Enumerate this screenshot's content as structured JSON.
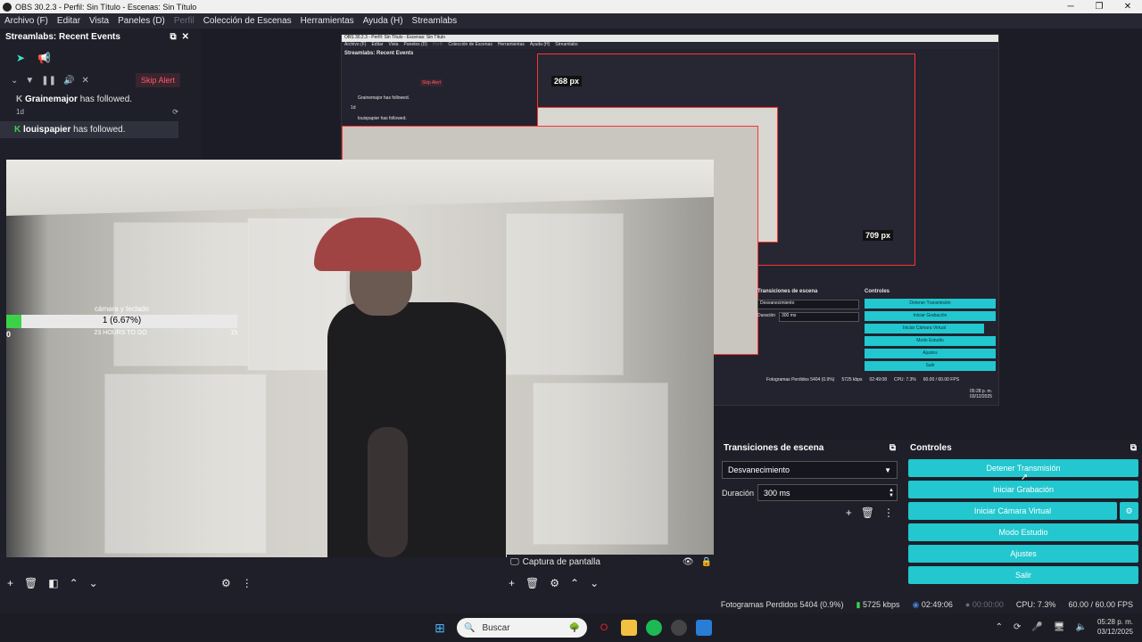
{
  "window": {
    "title": "OBS 30.2.3 - Perfil: Sin Título - Escenas: Sin Título"
  },
  "menu": [
    {
      "label": "Archivo (F)",
      "enabled": true
    },
    {
      "label": "Editar",
      "enabled": true
    },
    {
      "label": "Vista",
      "enabled": true
    },
    {
      "label": "Paneles (D)",
      "enabled": true
    },
    {
      "label": "Perfil",
      "enabled": false
    },
    {
      "label": "Colección de Escenas",
      "enabled": true
    },
    {
      "label": "Herramientas",
      "enabled": true
    },
    {
      "label": "Ayuda (H)",
      "enabled": true
    },
    {
      "label": "Streamlabs",
      "enabled": true
    }
  ],
  "events_panel": {
    "title": "Streamlabs: Recent Events",
    "skip_alert": "Skip Alert",
    "events": [
      {
        "user": "Grainemajor",
        "action": " has followed.",
        "time": "1d"
      },
      {
        "user": "louispapier",
        "action": " has followed.",
        "time": ""
      }
    ]
  },
  "nested": {
    "title": "OBS 30.2.3 - Perfil: Sin Título - Escenas: Sin Título",
    "menu": [
      "Archivo (F)",
      "Editar",
      "Vista",
      "Paneles (D)",
      "Perfil",
      "Colección de Escenas",
      "Herramientas",
      "Ayuda (H)",
      "Streamlabs"
    ],
    "events_title": "Streamlabs: Recent Events",
    "skip_alert": "Skip Alert",
    "ev1": "Grainemajor has followed.",
    "ev1_time": "1d",
    "ev2": "louispapier has followed.",
    "px_label_1": "268 px",
    "px_label_2": "709 px",
    "trans_title": "Transiciones de escena",
    "ctrl_title": "Controles",
    "trans_select": "Desvanecimiento",
    "dur_label": "Duración",
    "dur_value": "300 ms",
    "buttons": [
      "Detener Transmisión",
      "Iniciar Grabación",
      "Iniciar Cámara Virtual",
      "Modo Estudio",
      "Ajustes",
      "Salir"
    ],
    "status": "Fotogramas Perdidos 5404 (0.9%)",
    "kbps": "5725 kbps",
    "time": "02:49:08",
    "cpu": "CPU: 7.3%",
    "fps": "60.00 / 60.00 FPS",
    "clock_time": "05:28 p. m.",
    "clock_date": "03/12/2025"
  },
  "progress_widget": {
    "title": "cámara y teclado",
    "value_text": "1 (6.67%)",
    "fraction": 0.0667,
    "min": "0",
    "max": "15",
    "subtitle": "23 HOURS TO GO"
  },
  "source": {
    "label": "Captura de pantalla"
  },
  "transitions": {
    "title": "Transiciones de escena",
    "selected": "Desvanecimiento",
    "duration_label": "Duración",
    "duration_value": "300 ms"
  },
  "controls": {
    "title": "Controles",
    "stop_stream": "Detener Transmisión",
    "start_recording": "Iniciar Grabación",
    "virtual_cam": "Iniciar Cámara Virtual",
    "studio_mode": "Modo Estudio",
    "settings": "Ajustes",
    "exit": "Salir"
  },
  "status": {
    "dropped": "Fotogramas Perdidos 5404 (0.9%)",
    "kbps": "5725 kbps",
    "stream_time": "02:49:06",
    "rec_time": "00:00:00",
    "cpu": "CPU: 7.3%",
    "fps": "60.00 / 60.00 FPS"
  },
  "taskbar": {
    "search_placeholder": "Buscar",
    "clock_time": "05:28 p. m.",
    "clock_date": "03/12/2025"
  },
  "colors": {
    "accent": "#22c7cf",
    "danger": "#ff3333",
    "progress": "#3bd24a",
    "bg": "#1e1f29"
  }
}
